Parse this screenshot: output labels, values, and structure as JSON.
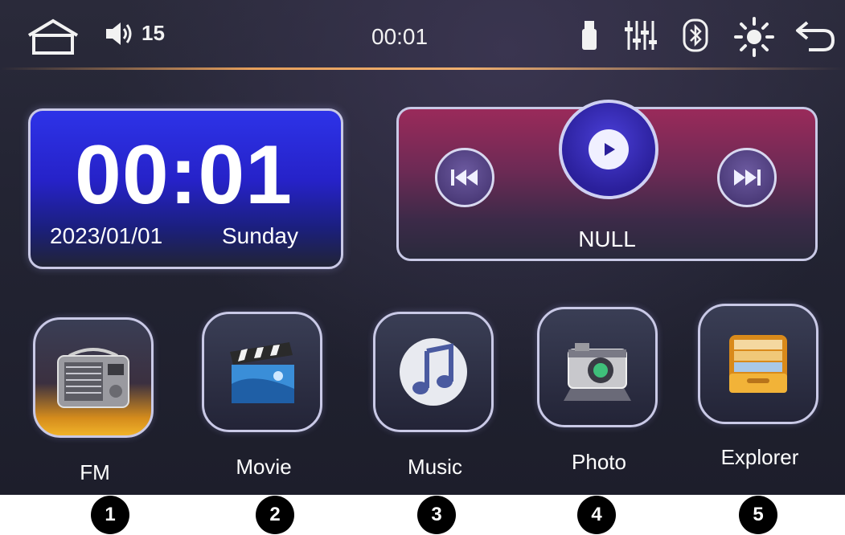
{
  "status_bar": {
    "volume": "15",
    "time": "00:01",
    "icons": [
      "home-icon",
      "volume-icon",
      "usb-icon",
      "equalizer-icon",
      "bluetooth-icon",
      "brightness-icon",
      "back-icon"
    ]
  },
  "clock_widget": {
    "time": "00:01",
    "date": "2023/01/01",
    "day": "Sunday"
  },
  "media_widget": {
    "track": "NULL",
    "controls": [
      "previous-icon",
      "play-icon",
      "next-icon"
    ]
  },
  "apps": [
    {
      "label": "FM",
      "icon": "radio-icon"
    },
    {
      "label": "Movie",
      "icon": "clapperboard-icon"
    },
    {
      "label": "Music",
      "icon": "music-note-icon"
    },
    {
      "label": "Photo",
      "icon": "camera-icon"
    },
    {
      "label": "Explorer",
      "icon": "folder-icon"
    }
  ],
  "markers": [
    "1",
    "2",
    "3",
    "4",
    "5"
  ],
  "colors": {
    "clock_bg": "#2d33e8",
    "media_bg": "#9a2a5a",
    "fm_glow": "#f0b32a",
    "accent_line": "#e7a05c"
  }
}
